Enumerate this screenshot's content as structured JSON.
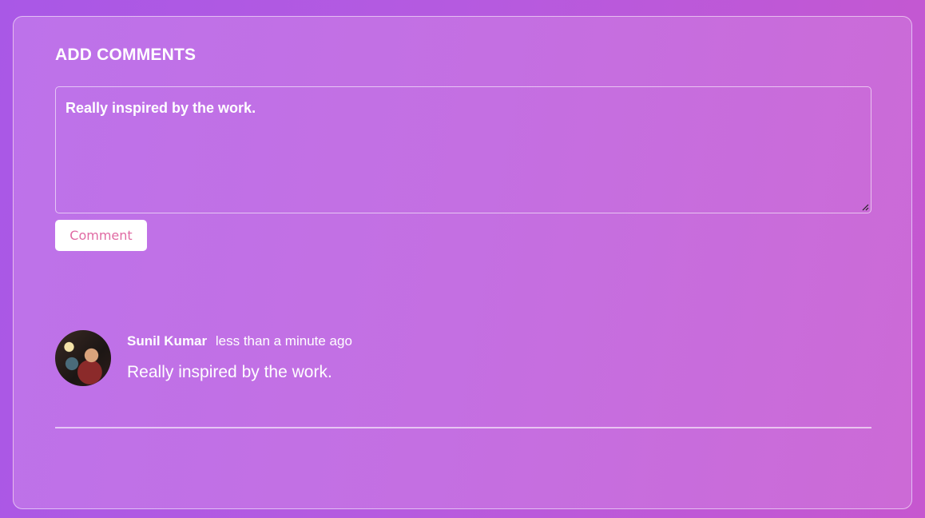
{
  "form": {
    "heading": "ADD COMMENTS",
    "textarea_value": "Really inspired by the work.",
    "submit_label": "Comment"
  },
  "comments": [
    {
      "author": "Sunil Kumar",
      "time": "less than a minute ago",
      "text": "Really inspired by the work.",
      "avatar_icon": "user-photo"
    }
  ],
  "colors": {
    "accent": "#e06aa3",
    "text": "#ffffff",
    "background_start": "#a958e6",
    "background_end": "#c657cf"
  }
}
